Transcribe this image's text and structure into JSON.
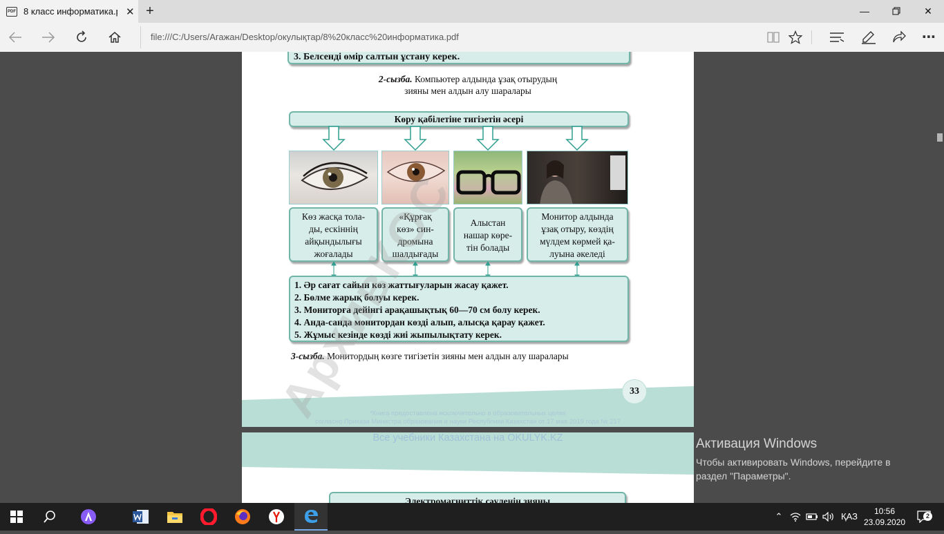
{
  "browser": {
    "tab_title": "8 класс информатика.p",
    "tab_icon": "pdf-icon",
    "new_tab": "+",
    "address": "file:///C:/Users/Агажан/Desktop/окулықтар/8%20класс%20информатика.pdf",
    "window_controls": [
      "minimize",
      "maximize",
      "close"
    ]
  },
  "page": {
    "top_item": "3. Белсенді өмір салтын ұстану керек.",
    "caption2_label": "2-сызба.",
    "caption2_line1": "Компьютер алдында ұзақ отырудың",
    "caption2_line2": "зияны мен алдын алу шаралары",
    "header_box": "Көру қабілетіне тигізетін әсері",
    "effects": [
      {
        "line1": "Көз жасқа тола-",
        "line2": "ды, ескіннің",
        "line3": "айқындылығы",
        "line4": "жоғалады"
      },
      {
        "line1": "«Құрғақ",
        "line2": "көз» син-",
        "line3": "дромына",
        "line4": "шалдығады"
      },
      {
        "line1": "Алыстан",
        "line2": "нашар көре-",
        "line3": "тін болады",
        "line4": ""
      },
      {
        "line1": "Монитор алдында",
        "line2": "ұзақ отыру, көздің",
        "line3": "мүлдем көрмей қа-",
        "line4": "луына әкеледі"
      }
    ],
    "photos": [
      "eye-photo",
      "red-eye-photo",
      "glasses-photo",
      "woman-at-monitor-photo"
    ],
    "measures": [
      "1. Әр сағат сайын көз жаттығуларын жасау қажет.",
      "2. Бөлме жарық болуы керек.",
      "3. Мониторға дейінгі арақашықтық 60—70 см болу керек.",
      "4. Анда-санда монитордан көзді алып, алысқа қарау қажет.",
      "5. Жұмыс кезінде көзді жиі жыпылықтату керек."
    ],
    "caption3_label": "3-сызба.",
    "caption3_text": "Монитордың көзге тигізетін зияны мен алдын алу шаралары",
    "page_number": "33",
    "footer_line1": "*Книга предоставлена исключительно в образовательных целях",
    "footer_line2": "согласно Приказа Министра образования и науки Республики Казахстан от 17 мая 2019 года № 217",
    "watermark": "АрхивКОС",
    "page2_banner": "Все учебники Казахстана на OKULYK.KZ",
    "page2_box": "Электромагниттік сәуленің зияны"
  },
  "activation": {
    "title": "Активация Windows",
    "line1": "Чтобы активировать Windows, перейдите в",
    "line2": "раздел \"Параметры\"."
  },
  "taskbar": {
    "apps": [
      "windows-start-icon",
      "search-icon",
      "alice-icon",
      "word-icon",
      "explorer-icon",
      "opera-icon",
      "firefox-icon",
      "yandex-icon",
      "edge-icon"
    ],
    "lang": "ҚАЗ",
    "time": "10:56",
    "date": "23.09.2020",
    "notifications": "2"
  },
  "colors": {
    "box_fill": "#d7ede9",
    "box_border": "#6fb5a8",
    "band": "#b9ded5",
    "arrow": "#2f9e90"
  }
}
